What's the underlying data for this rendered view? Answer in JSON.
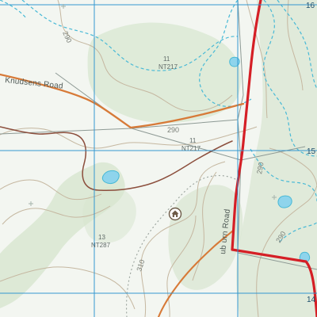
{
  "map": {
    "colors": {
      "background": "#f3f6f1",
      "vegetation": "#d7e6d0",
      "grid_line": "#2b93d0",
      "contour": "#c5b7a0",
      "creek": "#48b9d6",
      "track": "#8c4f3d",
      "road_major": "#d51f26",
      "road_minor": "#d77a38",
      "parcel_boundary": "#8e9a95"
    },
    "roads": {
      "knudsens": "Knudsens Road",
      "auburn": "ub urn Road"
    },
    "contours": {
      "c290_a": "290",
      "c290_b": "290",
      "c290_c": "290",
      "c290_d": "290",
      "c310": "310"
    },
    "parcels": [
      {
        "lot": "11",
        "plan": "NT217"
      },
      {
        "lot": "11",
        "plan": "NT217"
      },
      {
        "lot": "13",
        "plan": "NT287"
      }
    ],
    "grid_labels": {
      "top_right": "16",
      "mid_right": "15",
      "bottom_right": "14"
    },
    "icons": {
      "homestead": "house-icon"
    }
  }
}
